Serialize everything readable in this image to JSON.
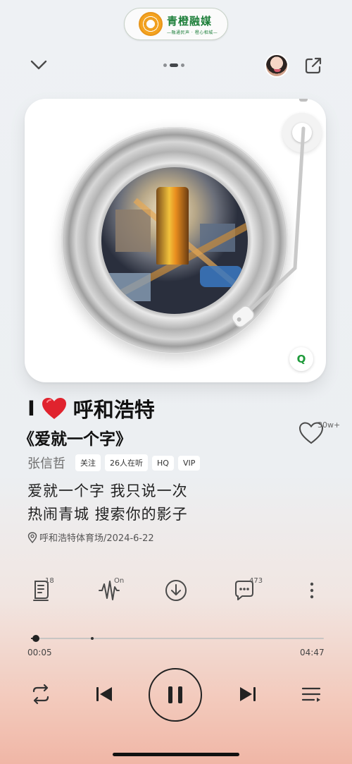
{
  "brand": {
    "name": "青橙融媒",
    "slogan": "—融通民声 · 橙心相城—"
  },
  "header": {
    "page_dots": 3,
    "active_dot": 1
  },
  "song": {
    "title_prefix": "I",
    "title_suffix": "呼和浩特",
    "subtitle": "《爱就一个字》",
    "artist": "张信哲",
    "tags": [
      "关注",
      "26人在听",
      "HQ",
      "VIP"
    ],
    "lyrics": [
      "爱就一个字 我只说一次",
      "热闹青城 搜索你的影子"
    ],
    "location": "呼和浩特体育场/2024-6-22",
    "like_count": "30w+",
    "badge": "Q"
  },
  "actions": {
    "comments_count_icon": "18",
    "sound_effect": "On",
    "chat_count": "473"
  },
  "playback": {
    "current": "00:05",
    "total": "04:47",
    "progress": 0.018,
    "buffered": 0.21
  },
  "colors": {
    "accent_green": "#1e9a3a",
    "heart_red": "#e0232e"
  }
}
